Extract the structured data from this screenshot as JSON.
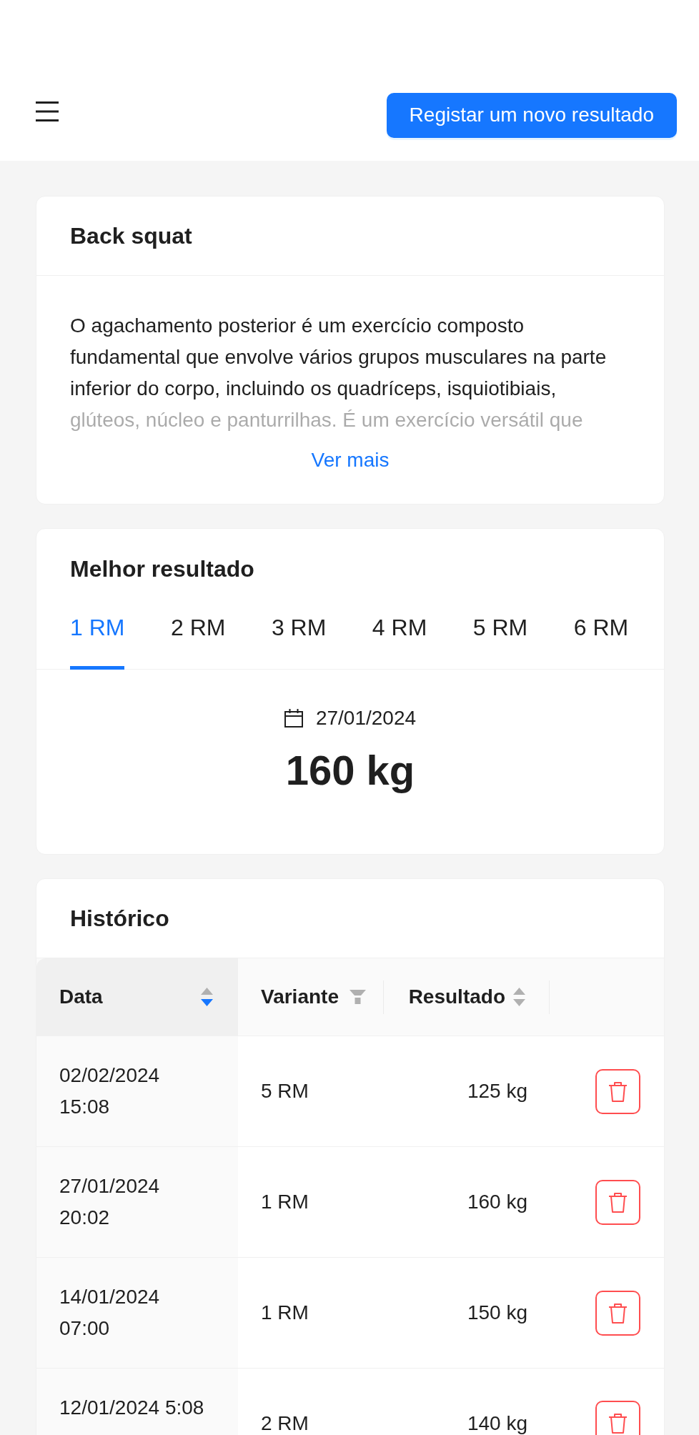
{
  "header": {
    "action": "Registar um novo resultado"
  },
  "exercise": {
    "title": "Back squat",
    "description": "O agachamento posterior é um exercício composto fundamental que envolve vários grupos musculares na parte inferior do corpo, incluindo os quadríceps, isquiotibiais, glúteos, núcleo e panturrilhas. É um exercício versátil que",
    "expanded": false,
    "toggle": "Ver mais"
  },
  "best": {
    "title": "Melhor resultado",
    "tabs": [
      {
        "label": "1 RM",
        "selected": true
      },
      {
        "label": "2 RM",
        "selected": false
      },
      {
        "label": "3 RM",
        "selected": false
      },
      {
        "label": "4 RM",
        "selected": false
      },
      {
        "label": "5 RM",
        "selected": false
      },
      {
        "label": "6 RM",
        "selected": false
      }
    ],
    "date": "27/01/2024",
    "value": "160 kg"
  },
  "history": {
    "title": "Histórico",
    "columns": [
      {
        "label": "Data",
        "kind": "sort",
        "sort_up": false,
        "sort_down": true
      },
      {
        "label": "Variante",
        "kind": "filter",
        "filtered": false
      },
      {
        "label": "Resultado",
        "kind": "sort",
        "sort_up": false,
        "sort_down": false
      }
    ],
    "rows": [
      {
        "date": "02/02/2024 15:08",
        "variant": "5 RM",
        "result": "125 kg"
      },
      {
        "date": "27/01/2024 20:02",
        "variant": "1 RM",
        "result": "160 kg"
      },
      {
        "date": "14/01/2024 07:00",
        "variant": "1 RM",
        "result": "150 kg"
      },
      {
        "date": "12/01/2024 5:08",
        "variant": "2 RM",
        "result": "140 kg"
      }
    ]
  }
}
